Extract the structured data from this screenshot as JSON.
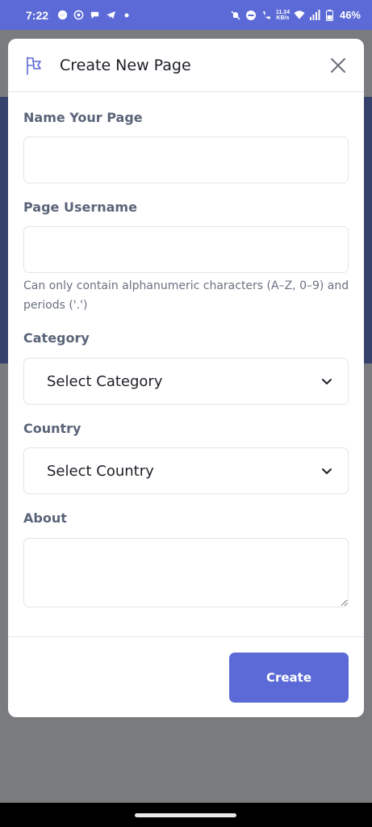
{
  "status_bar": {
    "time": "7:22",
    "battery": "46%",
    "net_speed_top": "11.34",
    "net_speed_bottom": "KB/s"
  },
  "modal": {
    "title": "Create New Page",
    "icon": "flag-icon",
    "fields": {
      "name": {
        "label": "Name Your Page",
        "value": ""
      },
      "username": {
        "label": "Page Username",
        "value": "",
        "help": "Can only contain alphanumeric characters (A–Z, 0–9) and periods ('.')"
      },
      "category": {
        "label": "Category",
        "selected": "Select Category"
      },
      "country": {
        "label": "Country",
        "selected": "Select Country"
      },
      "about": {
        "label": "About",
        "value": ""
      }
    },
    "create_label": "Create"
  },
  "colors": {
    "accent": "#5b6ad6",
    "label": "#5a6478",
    "backdrop": "#7a7b7e",
    "band": "#35426b"
  }
}
